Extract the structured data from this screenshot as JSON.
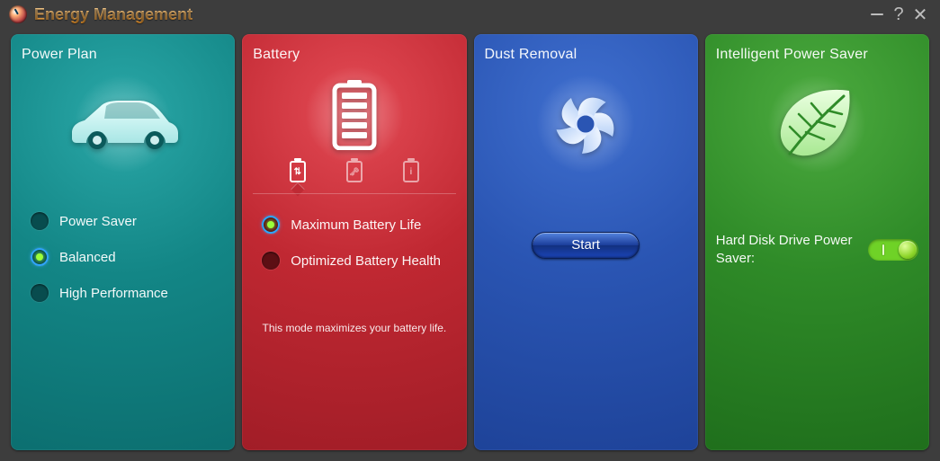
{
  "app": {
    "title": "Energy Management"
  },
  "powerPlan": {
    "heading": "Power Plan",
    "options": [
      {
        "label": "Power Saver",
        "selected": false
      },
      {
        "label": "Balanced",
        "selected": true
      },
      {
        "label": "High Performance",
        "selected": false
      }
    ]
  },
  "battery": {
    "heading": "Battery",
    "tabs": [
      {
        "icon": "arrows",
        "selected": true
      },
      {
        "icon": "key",
        "selected": false
      },
      {
        "icon": "info",
        "selected": false
      }
    ],
    "options": [
      {
        "label": "Maximum Battery Life",
        "selected": true
      },
      {
        "label": "Optimized Battery Health",
        "selected": false
      }
    ],
    "description": "This mode maximizes your battery life."
  },
  "dustRemoval": {
    "heading": "Dust Removal",
    "startLabel": "Start"
  },
  "powerSaver": {
    "heading": "Intelligent Power Saver",
    "hddLabel": "Hard Disk Drive Power Saver:",
    "hddOn": true
  }
}
